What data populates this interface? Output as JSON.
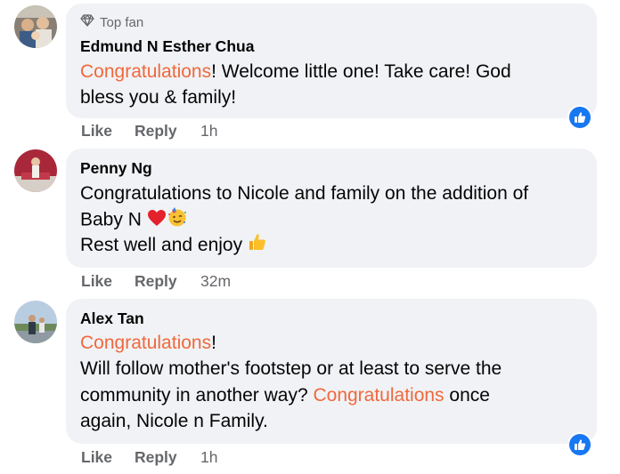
{
  "comments": [
    {
      "badge": "Top fan",
      "name": "Edmund N Esther Chua",
      "line1_hl": "Congratulations",
      "line1_rest": "! Welcome little one! Take care! God",
      "line2": "bless you & family!",
      "like": "Like",
      "reply": "Reply",
      "time": "1h"
    },
    {
      "name": "Penny Ng",
      "line1": "Congratulations to Nicole and family on the addition of",
      "line2": "Baby N",
      "line3": "Rest well and enjoy",
      "like": "Like",
      "reply": "Reply",
      "time": "32m"
    },
    {
      "name": "Alex Tan",
      "line1_hl": "Congratulations",
      "line1_rest": "!",
      "line2": "Will follow mother's footstep or at least to serve the",
      "line3_pre": "community in another way?",
      "line3_hl": "Congratulations",
      "line3_post": "once",
      "line4": "again, Nicole n Family.",
      "like": "Like",
      "reply": "Reply",
      "time": "1h"
    }
  ],
  "colors": {
    "highlight": "#f0683c",
    "bubble": "#f0f2f5",
    "meta": "#65676b",
    "like_blue": "#1877f2"
  }
}
